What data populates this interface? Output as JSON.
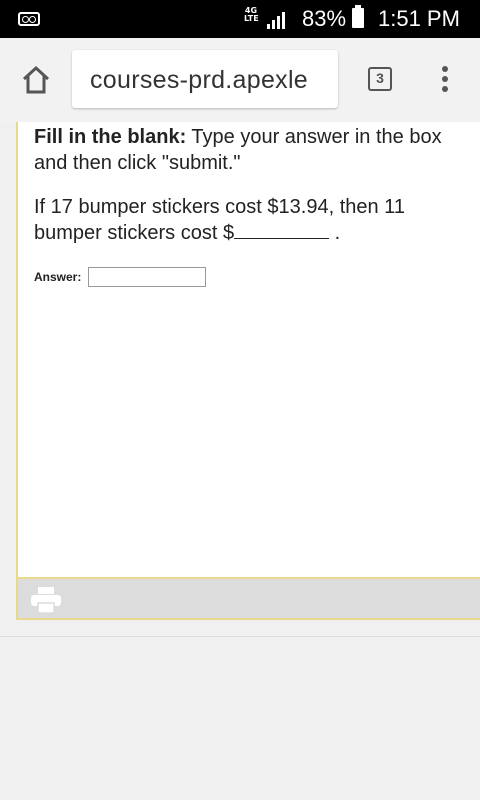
{
  "status_bar": {
    "network_label": "4G LTE",
    "battery_percent": "83%",
    "time": "1:51 PM"
  },
  "browser": {
    "url": "courses-prd.apexle",
    "tab_count": "3"
  },
  "question": {
    "instruction_bold": "Fill in the blank:",
    "instruction_text": " Type your answer in the box and then click \"submit.\"",
    "prompt_before_blank": "If 17 bumper stickers cost $13.94, then 11 bumper stickers cost $",
    "prompt_after_blank": ".",
    "answer_label": "Answer:",
    "answer_value": ""
  },
  "icons": {
    "status": [
      "voicemail-icon",
      "signal-icon",
      "battery-icon"
    ],
    "toolbar": [
      "home-icon",
      "tabs-icon",
      "menu-icon"
    ],
    "footer": [
      "print-icon"
    ]
  },
  "colors": {
    "frame_border": "#e8d98b",
    "footer_bg": "#dcdcdc"
  }
}
